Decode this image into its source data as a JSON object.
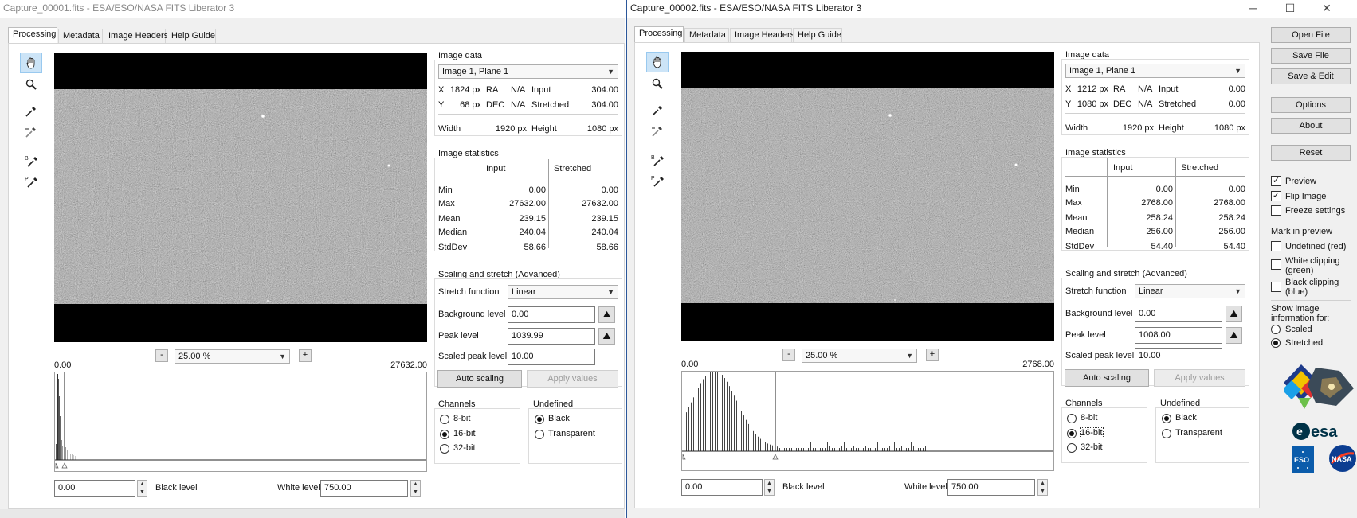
{
  "window1": {
    "title": "Capture_00001.fits - ESA/ESO/NASA FITS Liberator 3",
    "tabs": [
      "Processing",
      "Metadata",
      "Image Headers",
      "Help Guide"
    ],
    "zoom": "25.00 %",
    "zoom_minus": "-",
    "zoom_plus": "+",
    "hist_min": "0.00",
    "hist_max": "27632.00",
    "black_level_value": "0.00",
    "black_level_label": "Black level",
    "white_level_label": "White level",
    "white_level_value": "750.00",
    "image_data": {
      "group_label": "Image data",
      "plane": "Image 1, Plane 1",
      "x_label": "X",
      "x_value": "1824 px",
      "ra_label": "RA",
      "ra_value": "N/A",
      "input_label": "Input",
      "input_value": "304.00",
      "y_label": "Y",
      "y_value": "68 px",
      "dec_label": "DEC",
      "dec_value": "N/A",
      "stretched_label": "Stretched",
      "stretched_value": "304.00",
      "width_label": "Width",
      "width_value": "1920 px",
      "height_label": "Height",
      "height_value": "1080 px"
    },
    "statistics": {
      "group_label": "Image statistics",
      "col_input": "Input",
      "col_stretched": "Stretched",
      "rows": [
        {
          "label": "Min",
          "input": "0.00",
          "stretched": "0.00"
        },
        {
          "label": "Max",
          "input": "27632.00",
          "stretched": "27632.00"
        },
        {
          "label": "Mean",
          "input": "239.15",
          "stretched": "239.15"
        },
        {
          "label": "Median",
          "input": "240.04",
          "stretched": "240.04"
        },
        {
          "label": "StdDev",
          "input": "58.66",
          "stretched": "58.66"
        }
      ]
    },
    "scaling": {
      "group_label": "Scaling and stretch (Advanced)",
      "stretch_label": "Stretch function",
      "stretch_value": "Linear",
      "background_label": "Background level",
      "background_value": "0.00",
      "peak_label": "Peak level",
      "peak_value": "1039.99",
      "scaled_peak_label": "Scaled peak level",
      "scaled_peak_value": "10.00",
      "auto_scaling": "Auto scaling",
      "apply_values": "Apply values"
    },
    "channels": {
      "group_label": "Channels",
      "options": [
        "8-bit",
        "16-bit",
        "32-bit"
      ],
      "selected": "16-bit"
    },
    "undefined": {
      "group_label": "Undefined",
      "options": [
        "Black",
        "Transparent"
      ],
      "selected": "Black"
    }
  },
  "window2": {
    "title": "Capture_00002.fits - ESA/ESO/NASA FITS Liberator 3",
    "tabs": [
      "Processing",
      "Metadata",
      "Image Headers",
      "Help Guide"
    ],
    "window_controls": {
      "minimize": "─",
      "maximize": "☐",
      "close": "✕"
    },
    "zoom": "25.00 %",
    "zoom_minus": "-",
    "zoom_plus": "+",
    "hist_min": "0.00",
    "hist_max": "2768.00",
    "black_level_value": "0.00",
    "black_level_label": "Black level",
    "white_level_label": "White level",
    "white_level_value": "750.00",
    "image_data": {
      "group_label": "Image data",
      "plane": "Image 1, Plane 1",
      "x_label": "X",
      "x_value": "1212 px",
      "ra_label": "RA",
      "ra_value": "N/A",
      "input_label": "Input",
      "input_value": "0.00",
      "y_label": "Y",
      "y_value": "1080 px",
      "dec_label": "DEC",
      "dec_value": "N/A",
      "stretched_label": "Stretched",
      "stretched_value": "0.00",
      "width_label": "Width",
      "width_value": "1920 px",
      "height_label": "Height",
      "height_value": "1080 px"
    },
    "statistics": {
      "group_label": "Image statistics",
      "col_input": "Input",
      "col_stretched": "Stretched",
      "rows": [
        {
          "label": "Min",
          "input": "0.00",
          "stretched": "0.00"
        },
        {
          "label": "Max",
          "input": "2768.00",
          "stretched": "2768.00"
        },
        {
          "label": "Mean",
          "input": "258.24",
          "stretched": "258.24"
        },
        {
          "label": "Median",
          "input": "256.00",
          "stretched": "256.00"
        },
        {
          "label": "StdDev",
          "input": "54.40",
          "stretched": "54.40"
        }
      ]
    },
    "scaling": {
      "group_label": "Scaling and stretch (Advanced)",
      "stretch_label": "Stretch function",
      "stretch_value": "Linear",
      "background_label": "Background level",
      "background_value": "0.00",
      "peak_label": "Peak level",
      "peak_value": "1008.00",
      "scaled_peak_label": "Scaled peak level",
      "scaled_peak_value": "10.00",
      "auto_scaling": "Auto scaling",
      "apply_values": "Apply values"
    },
    "channels": {
      "group_label": "Channels",
      "options": [
        "8-bit",
        "16-bit",
        "32-bit"
      ],
      "selected": "16-bit"
    },
    "undefined": {
      "group_label": "Undefined",
      "options": [
        "Black",
        "Transparent"
      ],
      "selected": "Black"
    }
  },
  "sidebar": {
    "buttons": [
      "Open File",
      "Save File",
      "Save & Edit",
      "Options",
      "About",
      "Reset"
    ],
    "checks": [
      {
        "label": "Preview",
        "checked": true
      },
      {
        "label": "Flip Image",
        "checked": true
      },
      {
        "label": "Freeze settings",
        "checked": false
      }
    ],
    "mark_label": "Mark in preview",
    "marks": [
      {
        "label": "Undefined (red)",
        "checked": false
      },
      {
        "label": "White clipping (green)",
        "checked": false
      },
      {
        "label": "Black clipping (blue)",
        "checked": false
      }
    ],
    "show_info_label": "Show image information for:",
    "info_options": [
      "Scaled",
      "Stretched"
    ],
    "info_selected": "Stretched",
    "logos": {
      "esa": "esa",
      "eso": "ESO",
      "nasa": "NASA"
    }
  },
  "icons": [
    "hand-icon",
    "zoom-icon",
    "eyedropper-icon",
    "eyedropper-minus-icon",
    "eyedropper-b-icon",
    "eyedropper-p-icon"
  ],
  "colors": {
    "accent_selected": "#cce4f7",
    "window_border": "#2b579a",
    "panel_bg": "#f0f0f0"
  }
}
